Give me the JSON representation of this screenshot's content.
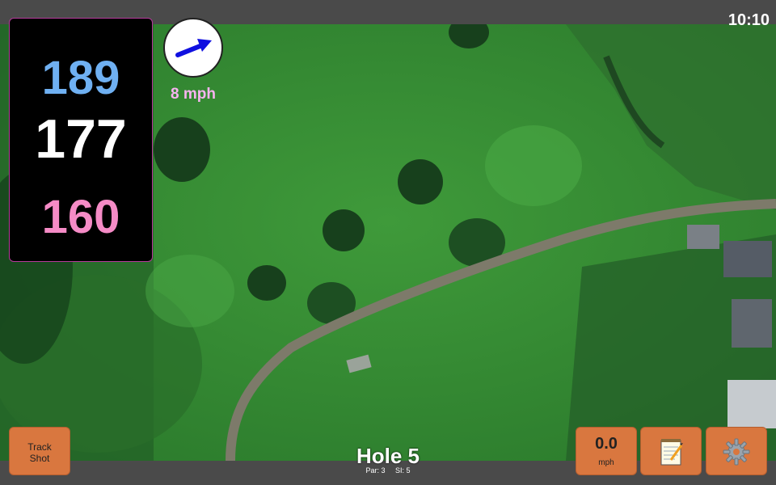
{
  "status": {
    "clock": "10:10"
  },
  "distances": {
    "back": "189",
    "center": "177",
    "front": "160",
    "colors": {
      "back": "#6fb0f2",
      "center": "#ffffff",
      "front": "#f58bc6"
    }
  },
  "wind": {
    "speed_label": "8 mph",
    "arrow_icon": "wind-direction-arrow-icon",
    "arrow_color": "#1010e0",
    "label_color": "#f7b3f0"
  },
  "hole": {
    "title": "Hole 5",
    "par_label": "Par: 3",
    "si_label": "SI: 5"
  },
  "buttons": {
    "track_shot_line1": "Track",
    "track_shot_line2": "Shot",
    "speed_value": "0.0",
    "speed_unit": "mph",
    "notes_icon": "notepad-icon",
    "settings_icon": "gear-icon",
    "color": "#d9773f"
  }
}
